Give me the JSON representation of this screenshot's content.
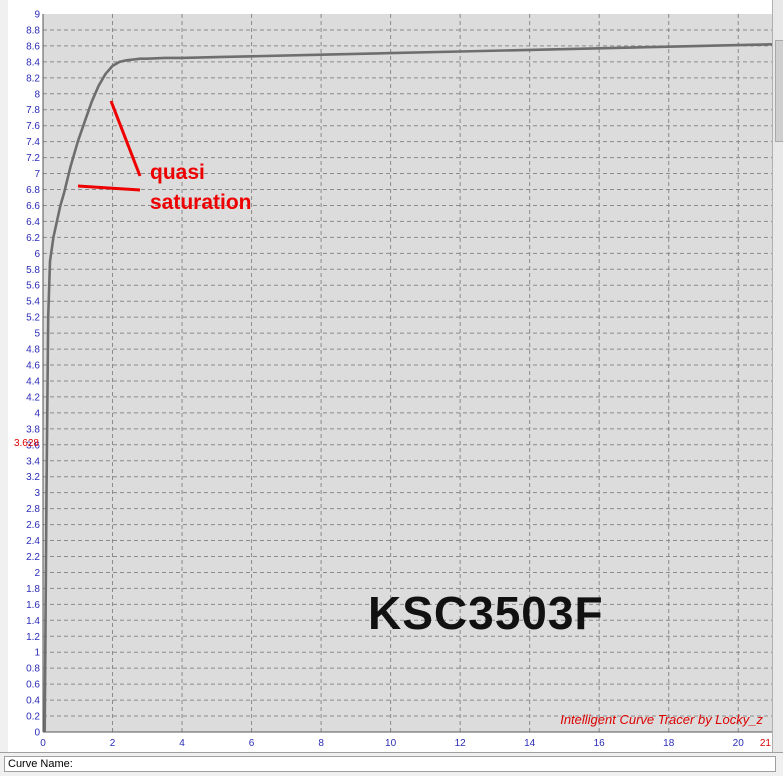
{
  "chart_data": {
    "type": "line",
    "xlim": [
      0,
      21
    ],
    "ylim": [
      0,
      9
    ],
    "x_ticks": [
      0,
      2,
      4,
      6,
      8,
      10,
      12,
      14,
      16,
      18,
      20
    ],
    "x_end_label": "21",
    "y_ticks": [
      0,
      0.2,
      0.4,
      0.6,
      0.8,
      1,
      1.2,
      1.4,
      1.6,
      1.8,
      2,
      2.2,
      2.4,
      2.6,
      2.8,
      3,
      3.2,
      3.4,
      3.6,
      3.8,
      4,
      4.2,
      4.4,
      4.6,
      4.8,
      5,
      5.2,
      5.4,
      5.6,
      5.8,
      6,
      6.2,
      6.4,
      6.6,
      6.8,
      7,
      7.2,
      7.4,
      7.6,
      7.8,
      8,
      8.2,
      8.4,
      8.6,
      8.8,
      9
    ],
    "cursor_y_label": "3.628",
    "grid": true,
    "series": [
      {
        "x": [
          0.05,
          0.1,
          0.15,
          0.2,
          0.3,
          0.4,
          0.5,
          0.6,
          0.8,
          1.0,
          1.2,
          1.4,
          1.6,
          1.8,
          2.0,
          2.2,
          2.4,
          2.6,
          2.8,
          3.0,
          3.5,
          4,
          5,
          6,
          8,
          10,
          12,
          14,
          16,
          18,
          20,
          21
        ],
        "y": [
          0.0,
          3.0,
          5.2,
          5.9,
          6.2,
          6.4,
          6.6,
          6.75,
          7.1,
          7.4,
          7.65,
          7.9,
          8.1,
          8.25,
          8.35,
          8.4,
          8.42,
          8.43,
          8.44,
          8.44,
          8.45,
          8.45,
          8.46,
          8.47,
          8.49,
          8.51,
          8.53,
          8.55,
          8.57,
          8.59,
          8.61,
          8.62
        ],
        "color": "#6e6e6e"
      }
    ],
    "annotations": {
      "label_line1": "quasi",
      "label_line2": "saturation",
      "pointer_color": "#ee0000",
      "device_label": "KSC3503F",
      "watermark": "Intelligent Curve Tracer by Locky_z"
    },
    "colors": {
      "plot_bg": "#dcdcdc",
      "grid": "#8a8a8a",
      "axis_text": "#2b2bb8",
      "accent_red": "#dd0000"
    }
  },
  "status_bar": {
    "curve_name_label": "Curve Name:"
  }
}
